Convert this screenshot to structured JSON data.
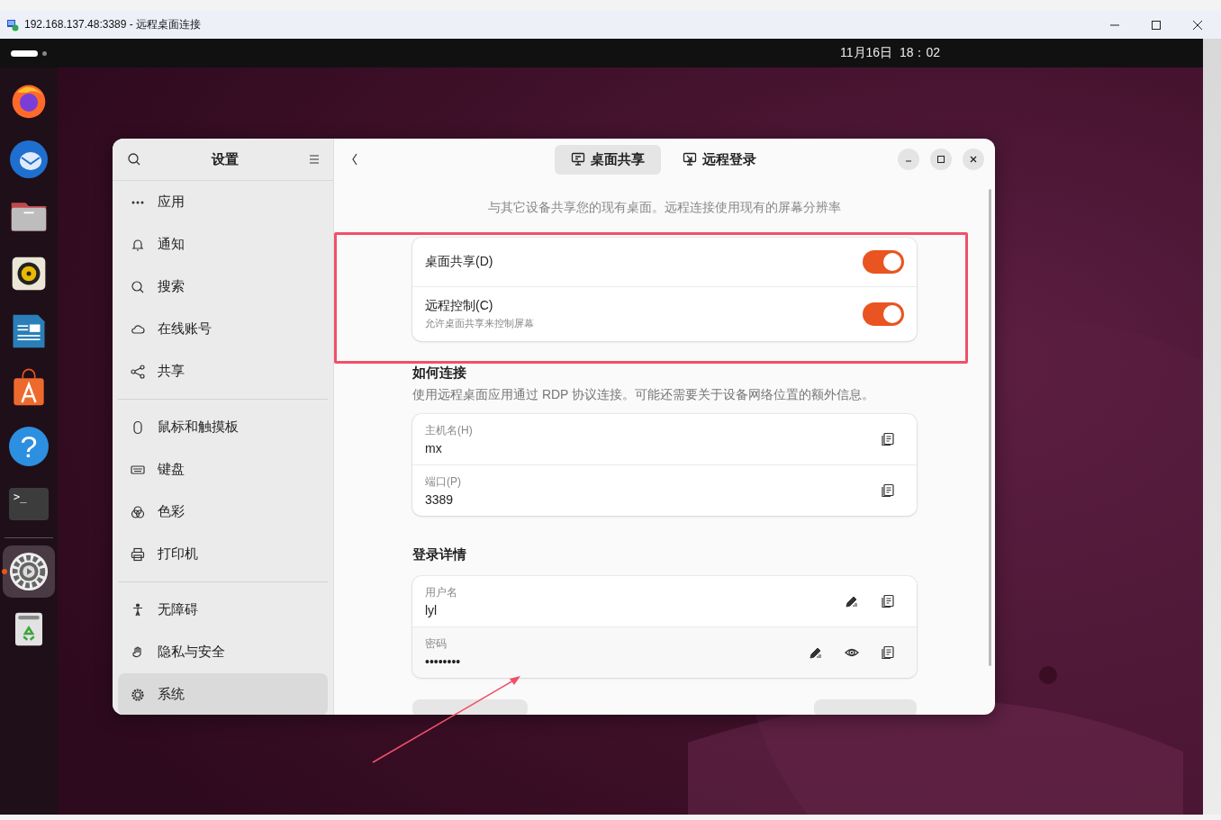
{
  "rdp_window": {
    "title": "192.168.137.48:3389 - 远程桌面连接"
  },
  "top_bar": {
    "clock": "11月16日  18：02"
  },
  "dock": [
    {
      "kind": "browser",
      "selected": false,
      "running": false
    },
    {
      "kind": "mail",
      "selected": false,
      "running": false
    },
    {
      "kind": "files",
      "selected": false,
      "running": false
    },
    {
      "kind": "music",
      "selected": false,
      "running": false
    },
    {
      "kind": "writer",
      "selected": false,
      "running": false
    },
    {
      "kind": "store",
      "selected": false,
      "running": false
    },
    {
      "kind": "help",
      "glyph": "?",
      "selected": false,
      "running": false
    },
    {
      "kind": "terminal",
      "glyph": ">_",
      "selected": false,
      "running": false
    },
    {
      "kind": "settings",
      "selected": true,
      "running": true
    },
    {
      "kind": "trash",
      "selected": false,
      "running": false
    }
  ],
  "settings": {
    "sidebar": {
      "title": "设置",
      "groups": [
        [
          {
            "label": "应用",
            "kind": "apps",
            "selected": false
          },
          {
            "label": "通知",
            "kind": "bell",
            "selected": false
          },
          {
            "label": "搜索",
            "kind": "search",
            "selected": false
          },
          {
            "label": "在线账号",
            "kind": "cloud",
            "selected": false
          },
          {
            "label": "共享",
            "kind": "share",
            "selected": false
          }
        ],
        [
          {
            "label": "鼠标和触摸板",
            "kind": "mouse",
            "selected": false
          },
          {
            "label": "键盘",
            "kind": "keyboard",
            "selected": false
          },
          {
            "label": "色彩",
            "kind": "color",
            "selected": false
          },
          {
            "label": "打印机",
            "kind": "printer",
            "selected": false
          }
        ],
        [
          {
            "label": "无障碍",
            "kind": "person",
            "selected": false
          },
          {
            "label": "隐私与安全",
            "kind": "hand",
            "selected": false
          },
          {
            "label": "系统",
            "kind": "gear",
            "selected": true
          }
        ]
      ]
    },
    "tabs": [
      {
        "label": "桌面共享",
        "kind": "monitor",
        "selected": true
      },
      {
        "label": "远程登录",
        "kind": "remote",
        "selected": false
      }
    ],
    "description": "与其它设备共享您的现有桌面。远程连接使用现有的屏幕分辨率",
    "toggles": [
      {
        "label": "桌面共享(D)",
        "on": true
      },
      {
        "label": "远程控制(C)",
        "subtitle": "允许桌面共享来控制屏幕",
        "on": true
      }
    ],
    "how_to_connect": {
      "heading": "如何连接",
      "text": "使用远程桌面应用通过 RDP 协议连接。可能还需要关于设备网络位置的额外信息。",
      "fields": [
        {
          "label": "主机名(H)",
          "value": "mx",
          "editable": false,
          "revealable": false
        },
        {
          "label": "端口(P)",
          "value": "3389",
          "editable": false,
          "revealable": false
        }
      ]
    },
    "login": {
      "heading": "登录详情",
      "fields": [
        {
          "label": "用户名",
          "value": "lyl",
          "editable": true,
          "revealable": false
        },
        {
          "label": "密码",
          "value": "••••••••",
          "editable": true,
          "revealable": true
        }
      ]
    }
  }
}
